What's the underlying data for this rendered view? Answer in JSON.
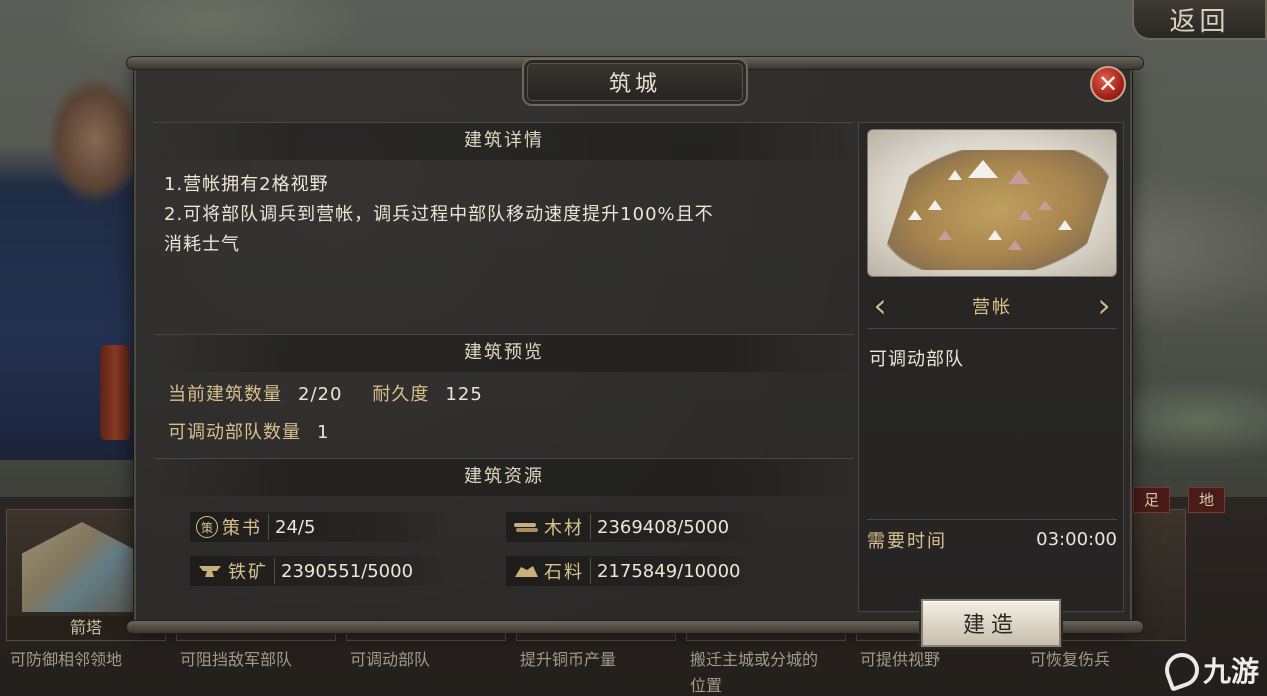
{
  "top": {
    "return_label": "返回"
  },
  "dialog": {
    "title": "筑城",
    "close_icon": "close-x-icon",
    "details": {
      "heading": "建筑详情",
      "line1": "1.营帐拥有2格视野",
      "line2": "2.可将部队调兵到营帐，调兵过程中部队移动速度提升100%且不",
      "line3": "消耗士气"
    },
    "preview": {
      "heading": "建筑预览",
      "count_label": "当前建筑数量",
      "count_value": "2/20",
      "durability_label": "耐久度",
      "durability_value": "125",
      "troops_label": "可调动部队数量",
      "troops_value": "1"
    },
    "resources": {
      "heading": "建筑资源",
      "items": [
        {
          "icon": "strategy-book-icon",
          "icon_glyph": "策",
          "label": "策书",
          "value": "24/5"
        },
        {
          "icon": "wood-icon",
          "icon_glyph": "",
          "label": "木材",
          "value": "2369408/5000"
        },
        {
          "icon": "iron-anvil-icon",
          "icon_glyph": "",
          "label": "铁矿",
          "value": "2390551/5000"
        },
        {
          "icon": "stone-icon",
          "icon_glyph": "",
          "label": "石料",
          "value": "2175849/10000"
        }
      ]
    },
    "building": {
      "name": "营帐",
      "prev_glyph": "‹",
      "next_glyph": "›",
      "function": "可调动部队",
      "time_label": "需要时间",
      "time_value": "03:00:00",
      "build_label": "建造"
    }
  },
  "background_strip": {
    "cards": [
      {
        "name": "箭塔",
        "desc": "可防御相邻领地"
      },
      {
        "desc": "可阻挡敌军部队"
      },
      {
        "desc": "可调动部队"
      },
      {
        "desc": "提升铜币产量"
      },
      {
        "desc": "搬迁主城或分城的位置"
      },
      {
        "desc": "可提供视野"
      },
      {
        "desc": "可恢复伤兵"
      }
    ],
    "tags": [
      "足",
      "地"
    ]
  },
  "watermark": {
    "text": "九游"
  }
}
